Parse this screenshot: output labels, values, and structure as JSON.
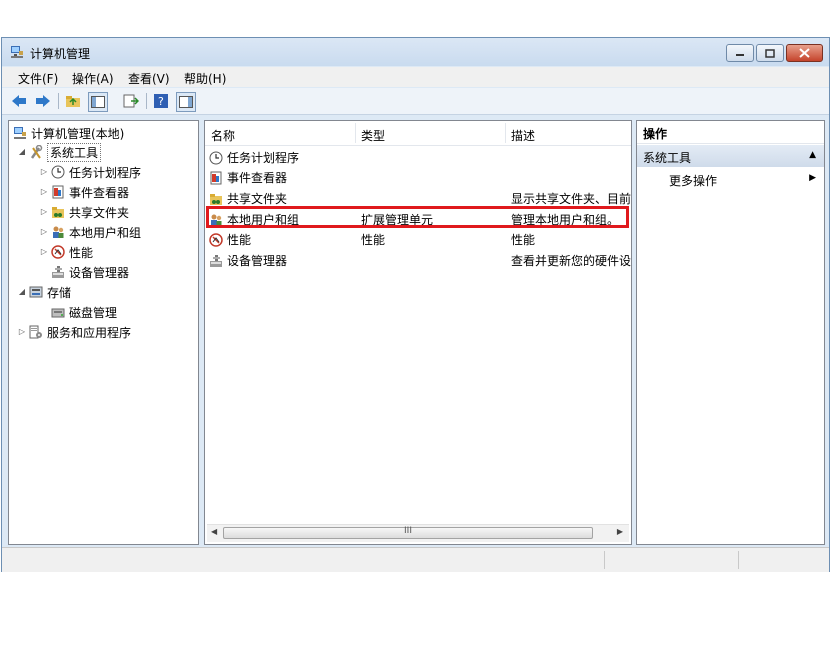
{
  "window": {
    "title": "计算机管理"
  },
  "menu": {
    "items": [
      "文件(F)",
      "操作(A)",
      "查看(V)",
      "帮助(H)"
    ]
  },
  "toolbar": {
    "icons": [
      "back-arrow-icon",
      "forward-arrow-icon",
      "up-folder-icon",
      "show-hide-tree-icon",
      "export-list-icon",
      "help-icon",
      "show-hide-action-pane-icon"
    ]
  },
  "tree": {
    "root": "计算机管理(本地)",
    "system_tools": "系统工具",
    "children": [
      "任务计划程序",
      "事件查看器",
      "共享文件夹",
      "本地用户和组",
      "性能",
      "设备管理器"
    ],
    "storage": "存储",
    "disk_management": "磁盘管理",
    "services": "服务和应用程序"
  },
  "list": {
    "columns": [
      "名称",
      "类型",
      "描述"
    ],
    "rows": [
      {
        "name": "任务计划程序",
        "type": "",
        "desc": ""
      },
      {
        "name": "事件查看器",
        "type": "",
        "desc": ""
      },
      {
        "name": "共享文件夹",
        "type": "",
        "desc": "显示共享文件夹、目前"
      },
      {
        "name": "本地用户和组",
        "type": "扩展管理单元",
        "desc": "管理本地用户和组。"
      },
      {
        "name": "性能",
        "type": "性能",
        "desc": "性能"
      },
      {
        "name": "设备管理器",
        "type": "",
        "desc": "查看并更新您的硬件设"
      }
    ],
    "scroll_thumb_label": "III"
  },
  "actions": {
    "title": "操作",
    "section": "系统工具",
    "more": "更多操作"
  },
  "colors": {
    "highlight": "#e0191d",
    "titlebar": "#c9dbef"
  }
}
